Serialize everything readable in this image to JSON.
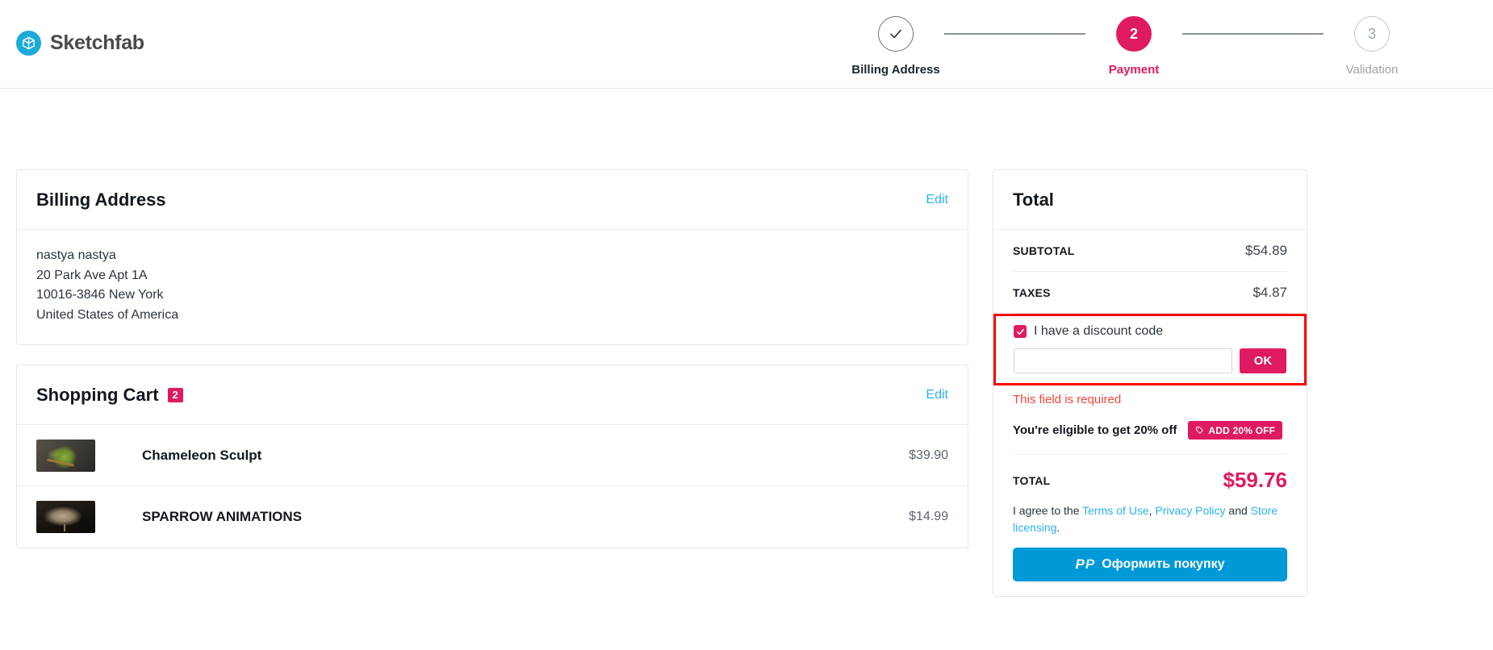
{
  "brand": {
    "name": "Sketchfab",
    "logo_icon": "sketchfab-cube-icon",
    "accent": "#1caad9"
  },
  "stepper": {
    "steps": [
      {
        "number": "",
        "label": "Billing Address",
        "state": "done",
        "icon": "check-icon"
      },
      {
        "number": "2",
        "label": "Payment",
        "state": "active"
      },
      {
        "number": "3",
        "label": "Validation",
        "state": "todo"
      }
    ],
    "active_color": "#e01a60"
  },
  "billing": {
    "title": "Billing Address",
    "edit_label": "Edit",
    "lines": [
      "nastya nastya",
      "20 Park Ave Apt 1A",
      "10016-3846 New York",
      "United States of America"
    ]
  },
  "cart": {
    "title": "Shopping Cart",
    "count": "2",
    "edit_label": "Edit",
    "items": [
      {
        "name": "Chameleon Sculpt",
        "price": "$39.90",
        "thumb": "chameleon"
      },
      {
        "name": "SPARROW ANIMATIONS",
        "price": "$14.99",
        "thumb": "sparrow"
      }
    ]
  },
  "total": {
    "title": "Total",
    "subtotal_label": "SUBTOTAL",
    "subtotal_value": "$54.89",
    "taxes_label": "TAXES",
    "taxes_value": "$4.87",
    "discount": {
      "checkbox_label": "I have a discount code",
      "checked": true,
      "input_value": "",
      "input_placeholder": "",
      "ok_label": "OK",
      "error": "This field is required",
      "highlight_color": "#ff0000"
    },
    "eligible_text": "You're eligible to get 20% off",
    "add_off_label": "ADD 20% OFF",
    "add_off_icon": "tag-icon",
    "grand_label": "TOTAL",
    "grand_value": "$59.76",
    "grand_color": "#e01a60",
    "agree_prefix": "I agree to the ",
    "terms_label": "Terms of Use",
    "agree_sep": ", ",
    "privacy_label": "Privacy Policy",
    "agree_and": " and ",
    "store_label": "Store licensing",
    "agree_suffix": ".",
    "paypal_label": "Оформить покупку",
    "paypal_logo": "PayPal"
  }
}
